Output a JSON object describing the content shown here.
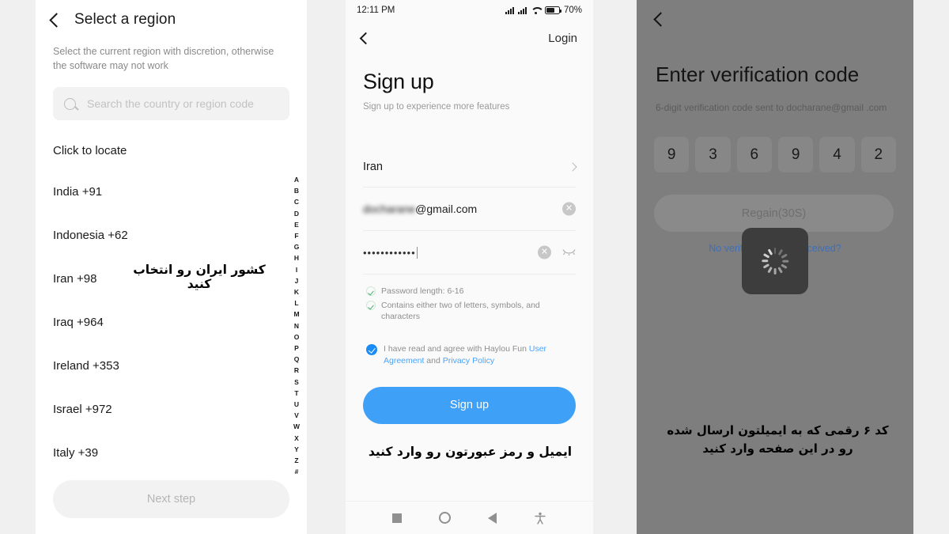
{
  "panel1": {
    "title": "Select a region",
    "back_icon": "chevron-left-icon",
    "subtitle": "Select the current region with discretion, otherwise the software may not work",
    "search": {
      "icon": "search-icon",
      "placeholder": "Search the country or region code",
      "value": ""
    },
    "locate_label": "Click to locate",
    "countries": [
      {
        "name": "India",
        "code": "+91"
      },
      {
        "name": "Indonesia",
        "code": "+62"
      },
      {
        "name": "Iran",
        "code": "+98"
      },
      {
        "name": "Iraq",
        "code": "+964"
      },
      {
        "name": "Ireland",
        "code": "+353"
      },
      {
        "name": "Israel",
        "code": "+972"
      },
      {
        "name": "Italy",
        "code": "+39"
      }
    ],
    "alpha_index": [
      "A",
      "B",
      "C",
      "D",
      "E",
      "F",
      "G",
      "H",
      "I",
      "J",
      "K",
      "L",
      "M",
      "N",
      "O",
      "P",
      "Q",
      "R",
      "S",
      "T",
      "U",
      "V",
      "W",
      "X",
      "Y",
      "Z",
      "#"
    ],
    "next_button": "Next step",
    "annotation": "کشور ایران رو انتخاب کنید"
  },
  "panel2": {
    "statusbar": {
      "time": "12:11 PM",
      "battery_percent": "70%",
      "signal_icon": "signal-bars-icon",
      "wifi_icon": "wifi-icon",
      "battery_icon": "battery-icon"
    },
    "back_icon": "chevron-left-icon",
    "login_link": "Login",
    "title": "Sign up",
    "subtitle": "Sign up to experience more features",
    "country_field": {
      "value": "Iran",
      "chevron_icon": "chevron-right-icon"
    },
    "email_field": {
      "redacted": "docharane",
      "visible": "@gmail.com",
      "clear_icon": "clear-circle-icon"
    },
    "password_field": {
      "masked": "••••••••••••",
      "clear_icon": "clear-circle-icon",
      "eye_icon": "eye-closed-icon"
    },
    "requirements": [
      "Password length: 6-16",
      "Contains either two of letters, symbols, and characters"
    ],
    "agreement": {
      "prefix": "I have read and agree with Haylou Fun ",
      "link1": "User Agreement",
      "middle": " and ",
      "link2": "Privacy Policy"
    },
    "signup_button": "Sign up",
    "annotation": "ایمیل و رمز عبورتون رو وارد کنید",
    "navbar": {
      "recents_icon": "square-recents-icon",
      "home_icon": "circle-home-icon",
      "back_icon": "triangle-back-icon",
      "accessibility_icon": "accessibility-icon"
    }
  },
  "panel3": {
    "back_icon": "chevron-left-icon",
    "title": "Enter verification code",
    "subtitle": "6-digit verification code sent to docharane@gmail .com",
    "otp_digits": [
      "9",
      "3",
      "6",
      "9",
      "4",
      "2"
    ],
    "regain_button": "Regain(30S)",
    "no_code_link": "No verification code received?",
    "loading_icon": "loading-spinner-icon",
    "annotation": "کد ۶ رقمی که به ایمیلتون ارسال شده رو در این صفحه وارد کنید"
  },
  "colors": {
    "accent_blue": "#3fa0f7",
    "link_blue": "#4da3f7",
    "panel3_bg": "#7e7e7e",
    "page_bg": "#f0f0f0"
  }
}
